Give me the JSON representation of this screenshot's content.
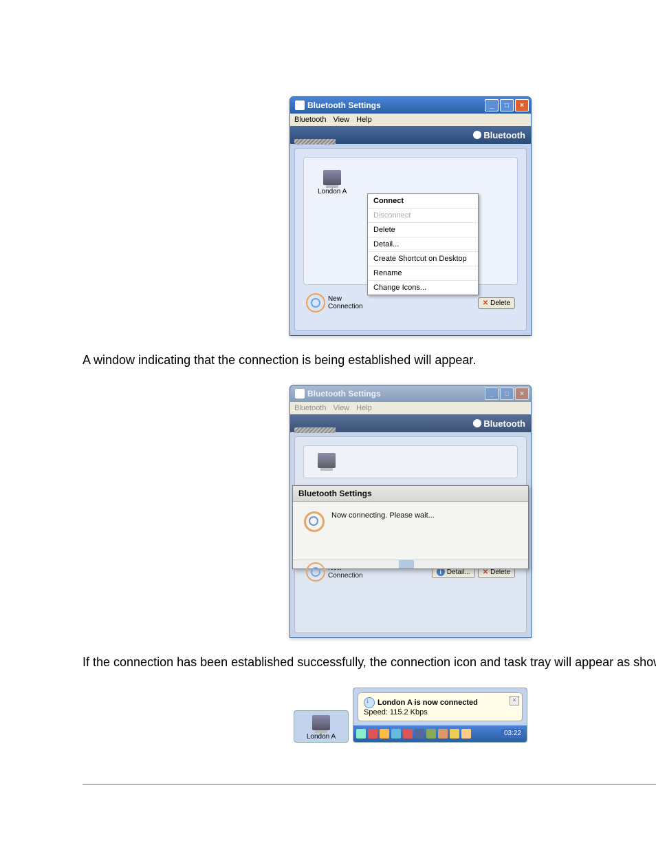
{
  "window1": {
    "title": "Bluetooth Settings",
    "menu": {
      "m1": "Bluetooth",
      "m2": "View",
      "m3": "Help"
    },
    "brand": "Bluetooth",
    "device_label": "London A",
    "context_menu": {
      "connect": "Connect",
      "disconnect": "Disconnect",
      "delete": "Delete",
      "detail": "Detail...",
      "shortcut": "Create Shortcut on Desktop",
      "rename": "Rename",
      "change_icons": "Change Icons..."
    },
    "new_connection": "New\nConnection",
    "delete_btn": "Delete"
  },
  "caption1": "A window indicating that the connection is being established will appear.",
  "window2": {
    "title": "Bluetooth Settings",
    "menu": {
      "m1": "Bluetooth",
      "m2": "View",
      "m3": "Help"
    },
    "brand": "Bluetooth",
    "dialog_title": "Bluetooth Settings",
    "dialog_msg": "Now connecting. Please wait...",
    "new_connection": "New\nConnection",
    "detail_btn": "Detail...",
    "delete_btn": "Delete"
  },
  "caption2": "If the connection has been established successfully, the connection icon and task tray will appear as shown below.",
  "tray": {
    "device_label": "London A",
    "balloon_title": "London A is now connected",
    "balloon_speed": "Speed: 115.2 Kbps",
    "clock": "03:22"
  }
}
